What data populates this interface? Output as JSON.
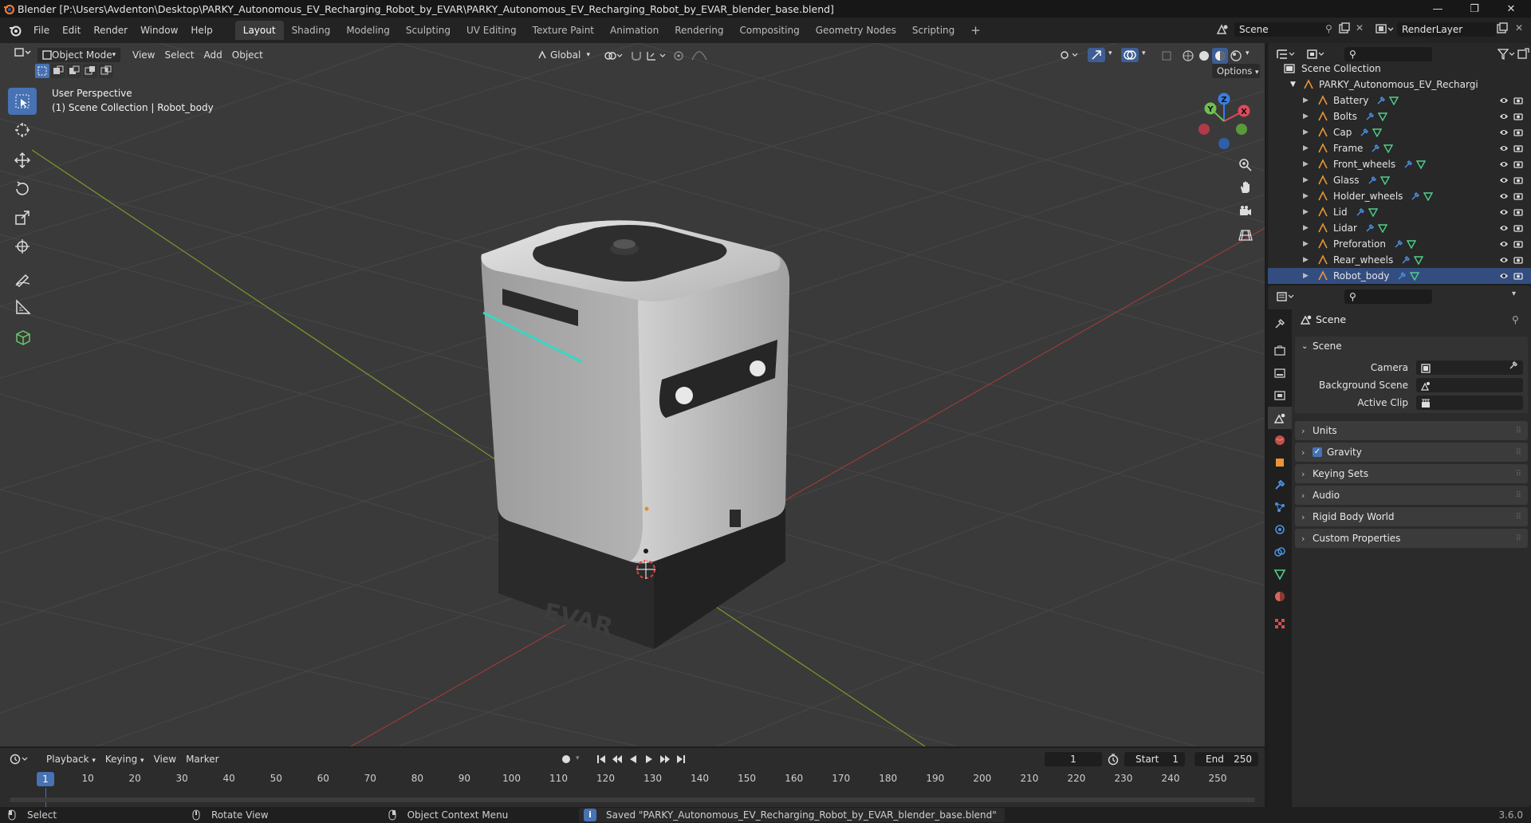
{
  "window": {
    "title": "Blender [P:\\Users\\Avdenton\\Desktop\\PARKY_Autonomous_EV_Recharging_Robot_by_EVAR\\PARKY_Autonomous_EV_Recharging_Robot_by_EVAR_blender_base.blend]",
    "minimize": "—",
    "maximize": "❐",
    "close": "✕"
  },
  "menu": {
    "items": [
      "File",
      "Edit",
      "Render",
      "Window",
      "Help"
    ],
    "workspaces": [
      "Layout",
      "Shading",
      "Modeling",
      "Sculpting",
      "UV Editing",
      "Texture Paint",
      "Animation",
      "Rendering",
      "Compositing",
      "Geometry Nodes",
      "Scripting"
    ],
    "active_workspace": "Layout",
    "add_workspace": "+",
    "scene": "Scene",
    "view_layer": "RenderLayer"
  },
  "viewport_header": {
    "mode": "Object Mode",
    "menus": [
      "View",
      "Select",
      "Add",
      "Object"
    ],
    "orientation": "Global",
    "options": "Options"
  },
  "viewport": {
    "view_name": "User Perspective",
    "context": "(1) Scene Collection | Robot_body",
    "gizmo": {
      "x": "X",
      "y": "Y",
      "z": "Z"
    },
    "logo_text": "EVAR"
  },
  "outliner": {
    "root": "Scene Collection",
    "collection": "PARKY_Autonomous_EV_Recharging_Ro",
    "objects": [
      "Battery",
      "Bolts",
      "Cap",
      "Frame",
      "Front_wheels",
      "Glass",
      "Holder_wheels",
      "Lid",
      "Lidar",
      "Preforation",
      "Rear_wheels",
      "Robot_body"
    ],
    "selected": "Robot_body"
  },
  "properties": {
    "context_title": "Scene",
    "panel_scene": "Scene",
    "fields": [
      {
        "label": "Camera",
        "value": ""
      },
      {
        "label": "Background Scene",
        "value": ""
      },
      {
        "label": "Active Clip",
        "value": ""
      }
    ],
    "panels": [
      "Units",
      "Gravity",
      "Keying Sets",
      "Audio",
      "Rigid Body World",
      "Custom Properties"
    ],
    "gravity_checked": true
  },
  "timeline": {
    "menus": [
      "Playback",
      "Keying",
      "View",
      "Marker"
    ],
    "current_frame": "1",
    "start_label": "Start",
    "start": "1",
    "end_label": "End",
    "end": "250",
    "ticks": [
      "1",
      "10",
      "20",
      "30",
      "40",
      "50",
      "60",
      "70",
      "80",
      "90",
      "100",
      "110",
      "120",
      "130",
      "140",
      "150",
      "160",
      "170",
      "180",
      "190",
      "200",
      "210",
      "220",
      "230",
      "240",
      "250"
    ]
  },
  "statusbar": {
    "select": "Select",
    "rotate": "Rotate View",
    "context_menu": "Object Context Menu",
    "message": "Saved \"PARKY_Autonomous_EV_Recharging_Robot_by_EVAR_blender_base.blend\"",
    "version": "3.6.0"
  }
}
